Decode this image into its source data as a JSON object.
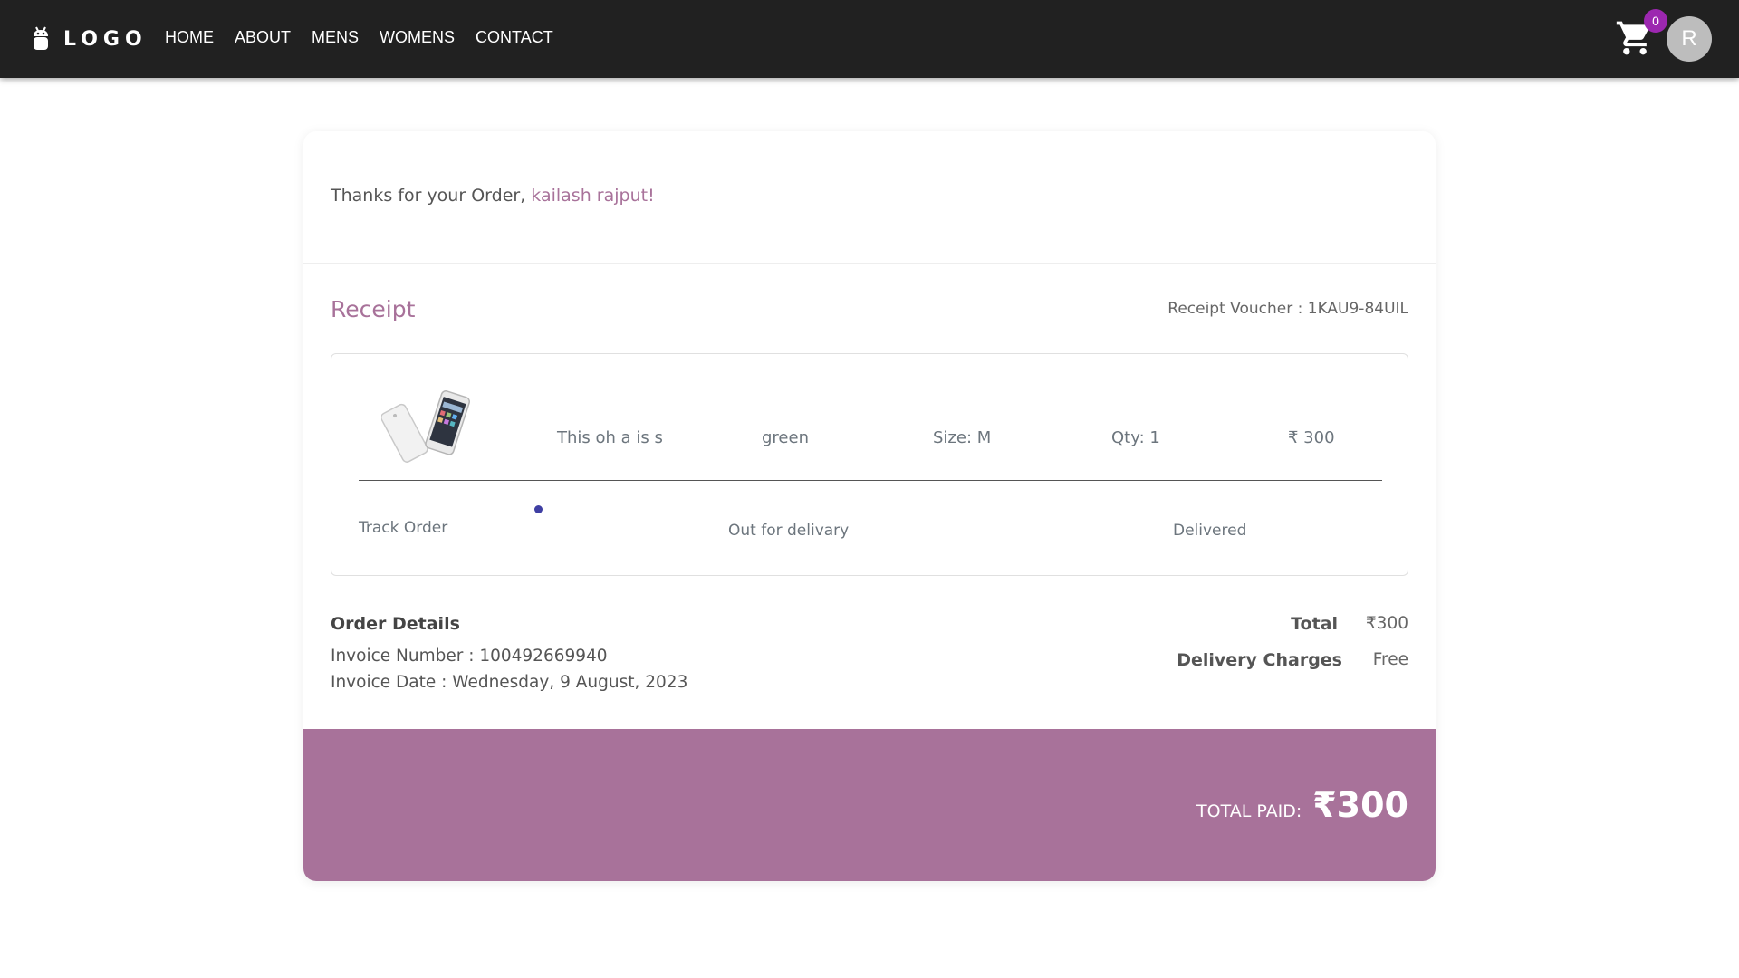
{
  "nav": {
    "brand": "LOGO",
    "links": [
      "HOME",
      "ABOUT",
      "MENS",
      "WOMENS",
      "CONTACT"
    ],
    "cart_count": "0",
    "avatar_initial": "R"
  },
  "header": {
    "greeting": "Thanks for your Order,",
    "customer_name": "kailash rajput",
    "punct": "!"
  },
  "receipt": {
    "title": "Receipt",
    "voucher": "Receipt Voucher : 1KAU9-84UIL"
  },
  "item": {
    "name": "This oh a is s",
    "color": "green",
    "size": "Size: M",
    "qty": "Qty: 1",
    "price": "₹ 300"
  },
  "tracking": {
    "label": "Track Order",
    "steps": [
      "Out for delivary",
      "Delivered"
    ]
  },
  "order_details": {
    "title": "Order Details",
    "invoice_number": "Invoice Number : 100492669940",
    "invoice_date": "Invoice Date : Wednesday, 9 August, 2023"
  },
  "totals": {
    "total_label": "Total",
    "total_value": "₹300",
    "delivery_label": "Delivery Charges",
    "delivery_value": "Free"
  },
  "footer": {
    "total_paid_label": "TOTAL PAID:",
    "total_paid_amount": "₹300"
  },
  "colors": {
    "accent": "#a8729a",
    "navbar": "#212121",
    "badge": "#9c27b0"
  }
}
